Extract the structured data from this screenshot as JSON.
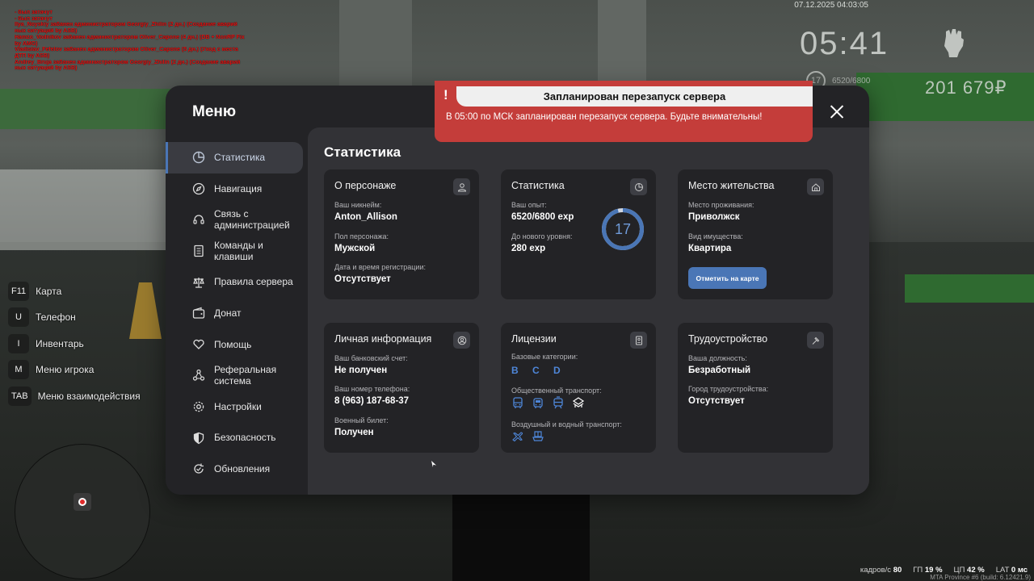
{
  "chat": [
    "- был затачут",
    "- был затачут",
    "Ilya_Noyskiy забанен администратором Georgiy_Zhilin (2 дн.) (Создание аварий",
    "ных ситуаций by ASB)",
    "Hamzo_Vodnikov забанен администратором Oliver_Capone (4 дн.) (DB + NonRP Fix",
    " by AMG)",
    "Vladislav_Fefelov забанен администратором Oliver_Capone (5 дн.) (Уход с места",
    " ДТП by ASB)",
    "Andrey_Bruja забанен администратором Georgiy_Zhilin (2 дн.) (Создание аварий",
    "ных ситуаций by ASB)"
  ],
  "hud": {
    "datetime": "07.12.2025 04:03:05",
    "clock": "05:41",
    "level": "17",
    "exp": "6520/6800",
    "money": "201 679₽"
  },
  "keybinds": [
    {
      "key": "F11",
      "label": "Карта"
    },
    {
      "key": "U",
      "label": "Телефон"
    },
    {
      "key": "I",
      "label": "Инвентарь"
    },
    {
      "key": "M",
      "label": "Меню игрока"
    },
    {
      "key": "TAB",
      "label": "Меню взаимодействия"
    }
  ],
  "stats": {
    "fps_label": "кадров/с",
    "fps": "80",
    "gpu_label": "ГП",
    "gpu": "19 %",
    "cpu_label": "ЦП",
    "cpu": "42 %",
    "lat_label": "LAT",
    "lat": "0 мс",
    "build": "MTA Province #6 (build: 6.12421.9)"
  },
  "notification": {
    "title": "Запланирован перезапуск сервера",
    "body": "В 05:00 по МСК запланирован перезапуск сервера. Будьте внимательны!",
    "mark": "!"
  },
  "menu": {
    "title": "Меню",
    "sidebar": [
      {
        "label": "Статистика",
        "icon": "pie-chart-icon",
        "active": true
      },
      {
        "label": "Навигация",
        "icon": "compass-icon"
      },
      {
        "label": "Связь с\nадминистрацией",
        "icon": "headset-icon"
      },
      {
        "label": "Команды и\nклавиши",
        "icon": "document-icon"
      },
      {
        "label": "Правила сервера",
        "icon": "scales-icon"
      },
      {
        "label": "Донат",
        "icon": "wallet-icon"
      },
      {
        "label": "Помощь",
        "icon": "heart-hand-icon"
      },
      {
        "label": "Реферальная\nсистема",
        "icon": "network-icon"
      },
      {
        "label": "Настройки",
        "icon": "gear-icon"
      },
      {
        "label": "Безопасность",
        "icon": "shield-icon"
      },
      {
        "label": "Обновления",
        "icon": "refresh-icon"
      }
    ],
    "content_title": "Статистика",
    "cards": {
      "character": {
        "title": "О персонаже",
        "nickname_label": "Ваш никнейм:",
        "nickname": "Anton_Allison",
        "gender_label": "Пол персонажа:",
        "gender": "Мужской",
        "reg_label": "Дата и время регистрации:",
        "reg": "Отсутствует"
      },
      "stats": {
        "title": "Статистика",
        "exp_label": "Ваш опыт:",
        "exp": "6520/6800 exp",
        "next_label": "До нового уровня:",
        "next": "280 exp",
        "level": "17",
        "progress": 0.9588
      },
      "residence": {
        "title": "Место жительства",
        "place_label": "Место проживания:",
        "place": "Приволжск",
        "property_label": "Вид имущества:",
        "property": "Квартира",
        "button": "Отметить на карте"
      },
      "personal": {
        "title": "Личная информация",
        "bank_label": "Ваш банковский счет:",
        "bank": "Не получен",
        "phone_label": "Ваш номер телефона:",
        "phone": "8 (963) 187-68-37",
        "military_label": "Военный билет:",
        "military": "Получен"
      },
      "licenses": {
        "title": "Лицензии",
        "base_label": "Базовые категории:",
        "base": "B C D",
        "public_label": "Общественный транспорт:",
        "air_label": "Воздушный и водный транспорт:"
      },
      "job": {
        "title": "Трудоустройство",
        "position_label": "Ваша должность:",
        "position": "Безработный",
        "city_label": "Город трудоустройства:",
        "city": "Отсутствует"
      }
    }
  },
  "colors": {
    "accent": "#4a76b6",
    "notification": "#c43d3a",
    "panel": "#232326",
    "content": "#323236"
  }
}
